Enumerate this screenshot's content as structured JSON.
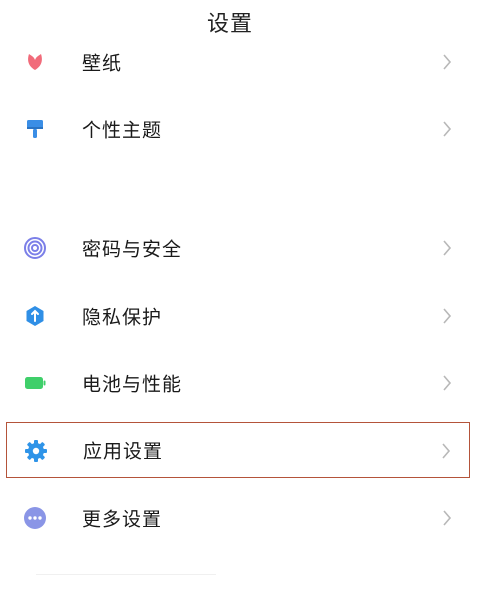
{
  "header": {
    "title": "设置"
  },
  "items": [
    {
      "label": "壁纸",
      "icon": "wallpaper-icon",
      "color": "#f16b7a"
    },
    {
      "label": "个性主题",
      "icon": "theme-brush-icon",
      "color": "#3a8ee6"
    },
    {
      "label": "密码与安全",
      "icon": "fingerprint-icon",
      "color": "#7b7fe8"
    },
    {
      "label": "隐私保护",
      "icon": "privacy-shield-icon",
      "color": "#2f8fe6"
    },
    {
      "label": "电池与性能",
      "icon": "battery-icon",
      "color": "#3fcf6a"
    },
    {
      "label": "应用设置",
      "icon": "gear-icon",
      "color": "#2f94e8",
      "highlighted": true
    },
    {
      "label": "更多设置",
      "icon": "more-dots-icon",
      "color": "#8a95e6"
    }
  ],
  "colors": {
    "highlight_border": "#b4543a",
    "chevron": "#b8b8b8"
  }
}
